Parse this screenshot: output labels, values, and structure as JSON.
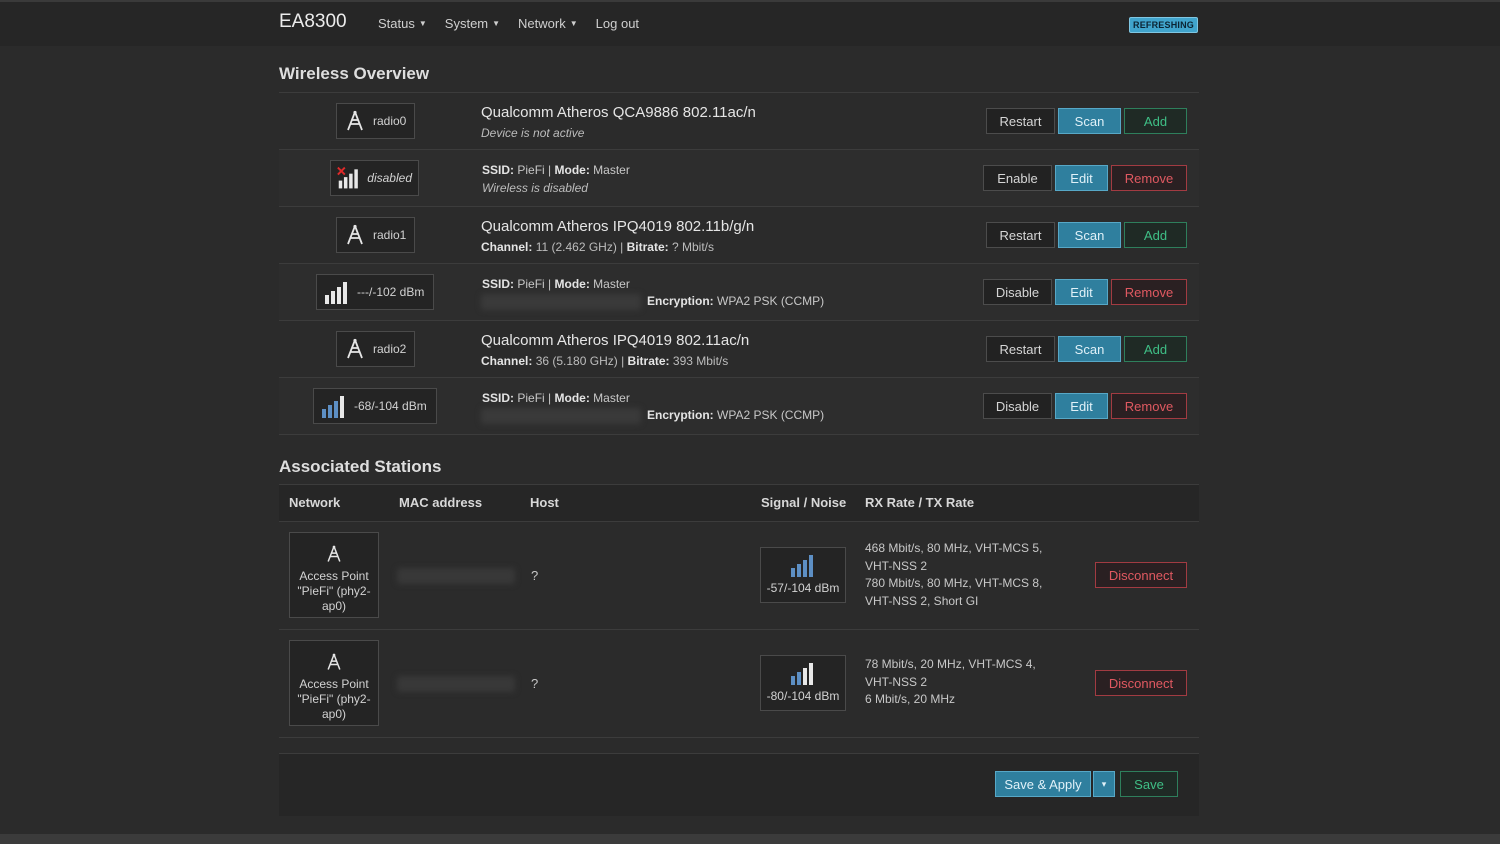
{
  "header": {
    "brand": "EA8300",
    "menu": [
      {
        "label": "Status"
      },
      {
        "label": "System"
      },
      {
        "label": "Network"
      },
      {
        "label": "Log out"
      }
    ],
    "badge": "REFRESHING"
  },
  "wireless": {
    "title": "Wireless Overview",
    "radios": [
      {
        "name": "radio0",
        "title": "Qualcomm Atheros QCA9886 802.11ac/n",
        "status": "Device is not active",
        "buttons": {
          "restart": "Restart",
          "scan": "Scan",
          "add": "Add"
        },
        "network": {
          "badge": "disabled",
          "ssid_label": "SSID:",
          "ssid": "PieFi",
          "mode_label": "Mode:",
          "mode": "Master",
          "status": "Wireless is disabled",
          "buttons": {
            "toggle": "Enable",
            "edit": "Edit",
            "remove": "Remove"
          }
        }
      },
      {
        "name": "radio1",
        "title": "Qualcomm Atheros IPQ4019 802.11b/g/n",
        "channel_label": "Channel:",
        "channel": "11 (2.462 GHz)",
        "bitrate_label": "Bitrate:",
        "bitrate": "? Mbit/s",
        "buttons": {
          "restart": "Restart",
          "scan": "Scan",
          "add": "Add"
        },
        "network": {
          "badge": "---/-102 dBm",
          "ssid_label": "SSID:",
          "ssid": "PieFi",
          "mode_label": "Mode:",
          "mode": "Master",
          "enc_label": "Encryption:",
          "encryption": "WPA2 PSK (CCMP)",
          "buttons": {
            "toggle": "Disable",
            "edit": "Edit",
            "remove": "Remove"
          }
        }
      },
      {
        "name": "radio2",
        "title": "Qualcomm Atheros IPQ4019 802.11ac/n",
        "channel_label": "Channel:",
        "channel": "36 (5.180 GHz)",
        "bitrate_label": "Bitrate:",
        "bitrate": "393 Mbit/s",
        "buttons": {
          "restart": "Restart",
          "scan": "Scan",
          "add": "Add"
        },
        "network": {
          "badge": "-68/-104 dBm",
          "ssid_label": "SSID:",
          "ssid": "PieFi",
          "mode_label": "Mode:",
          "mode": "Master",
          "enc_label": "Encryption:",
          "encryption": "WPA2 PSK (CCMP)",
          "buttons": {
            "toggle": "Disable",
            "edit": "Edit",
            "remove": "Remove"
          }
        }
      }
    ]
  },
  "stations": {
    "title": "Associated Stations",
    "columns": [
      "Network",
      "MAC address",
      "Host",
      "Signal / Noise",
      "RX Rate / TX Rate"
    ],
    "rows": [
      {
        "network": "Access Point \"PieFi\" (phy2-ap0)",
        "host": "?",
        "signal": "-57/-104 dBm",
        "rx_rate": "468 Mbit/s, 80 MHz, VHT-MCS 5, VHT-NSS 2",
        "tx_rate": "780 Mbit/s, 80 MHz, VHT-MCS 8, VHT-NSS 2, Short GI",
        "action": "Disconnect"
      },
      {
        "network": "Access Point \"PieFi\" (phy2-ap0)",
        "host": "?",
        "signal": "-80/-104 dBm",
        "rx_rate": "78 Mbit/s, 20 MHz, VHT-MCS 4, VHT-NSS 2",
        "tx_rate": "6 Mbit/s, 20 MHz",
        "action": "Disconnect"
      }
    ]
  },
  "footer": {
    "save_apply": "Save & Apply",
    "dropdown": "▾",
    "save": "Save"
  },
  "colors": {
    "background": "#2b2b2b",
    "primary_button": "#2f7f9e",
    "add_green": "#3fbf86",
    "remove_red": "#e05961",
    "badge_blue": "#40a4cc"
  }
}
